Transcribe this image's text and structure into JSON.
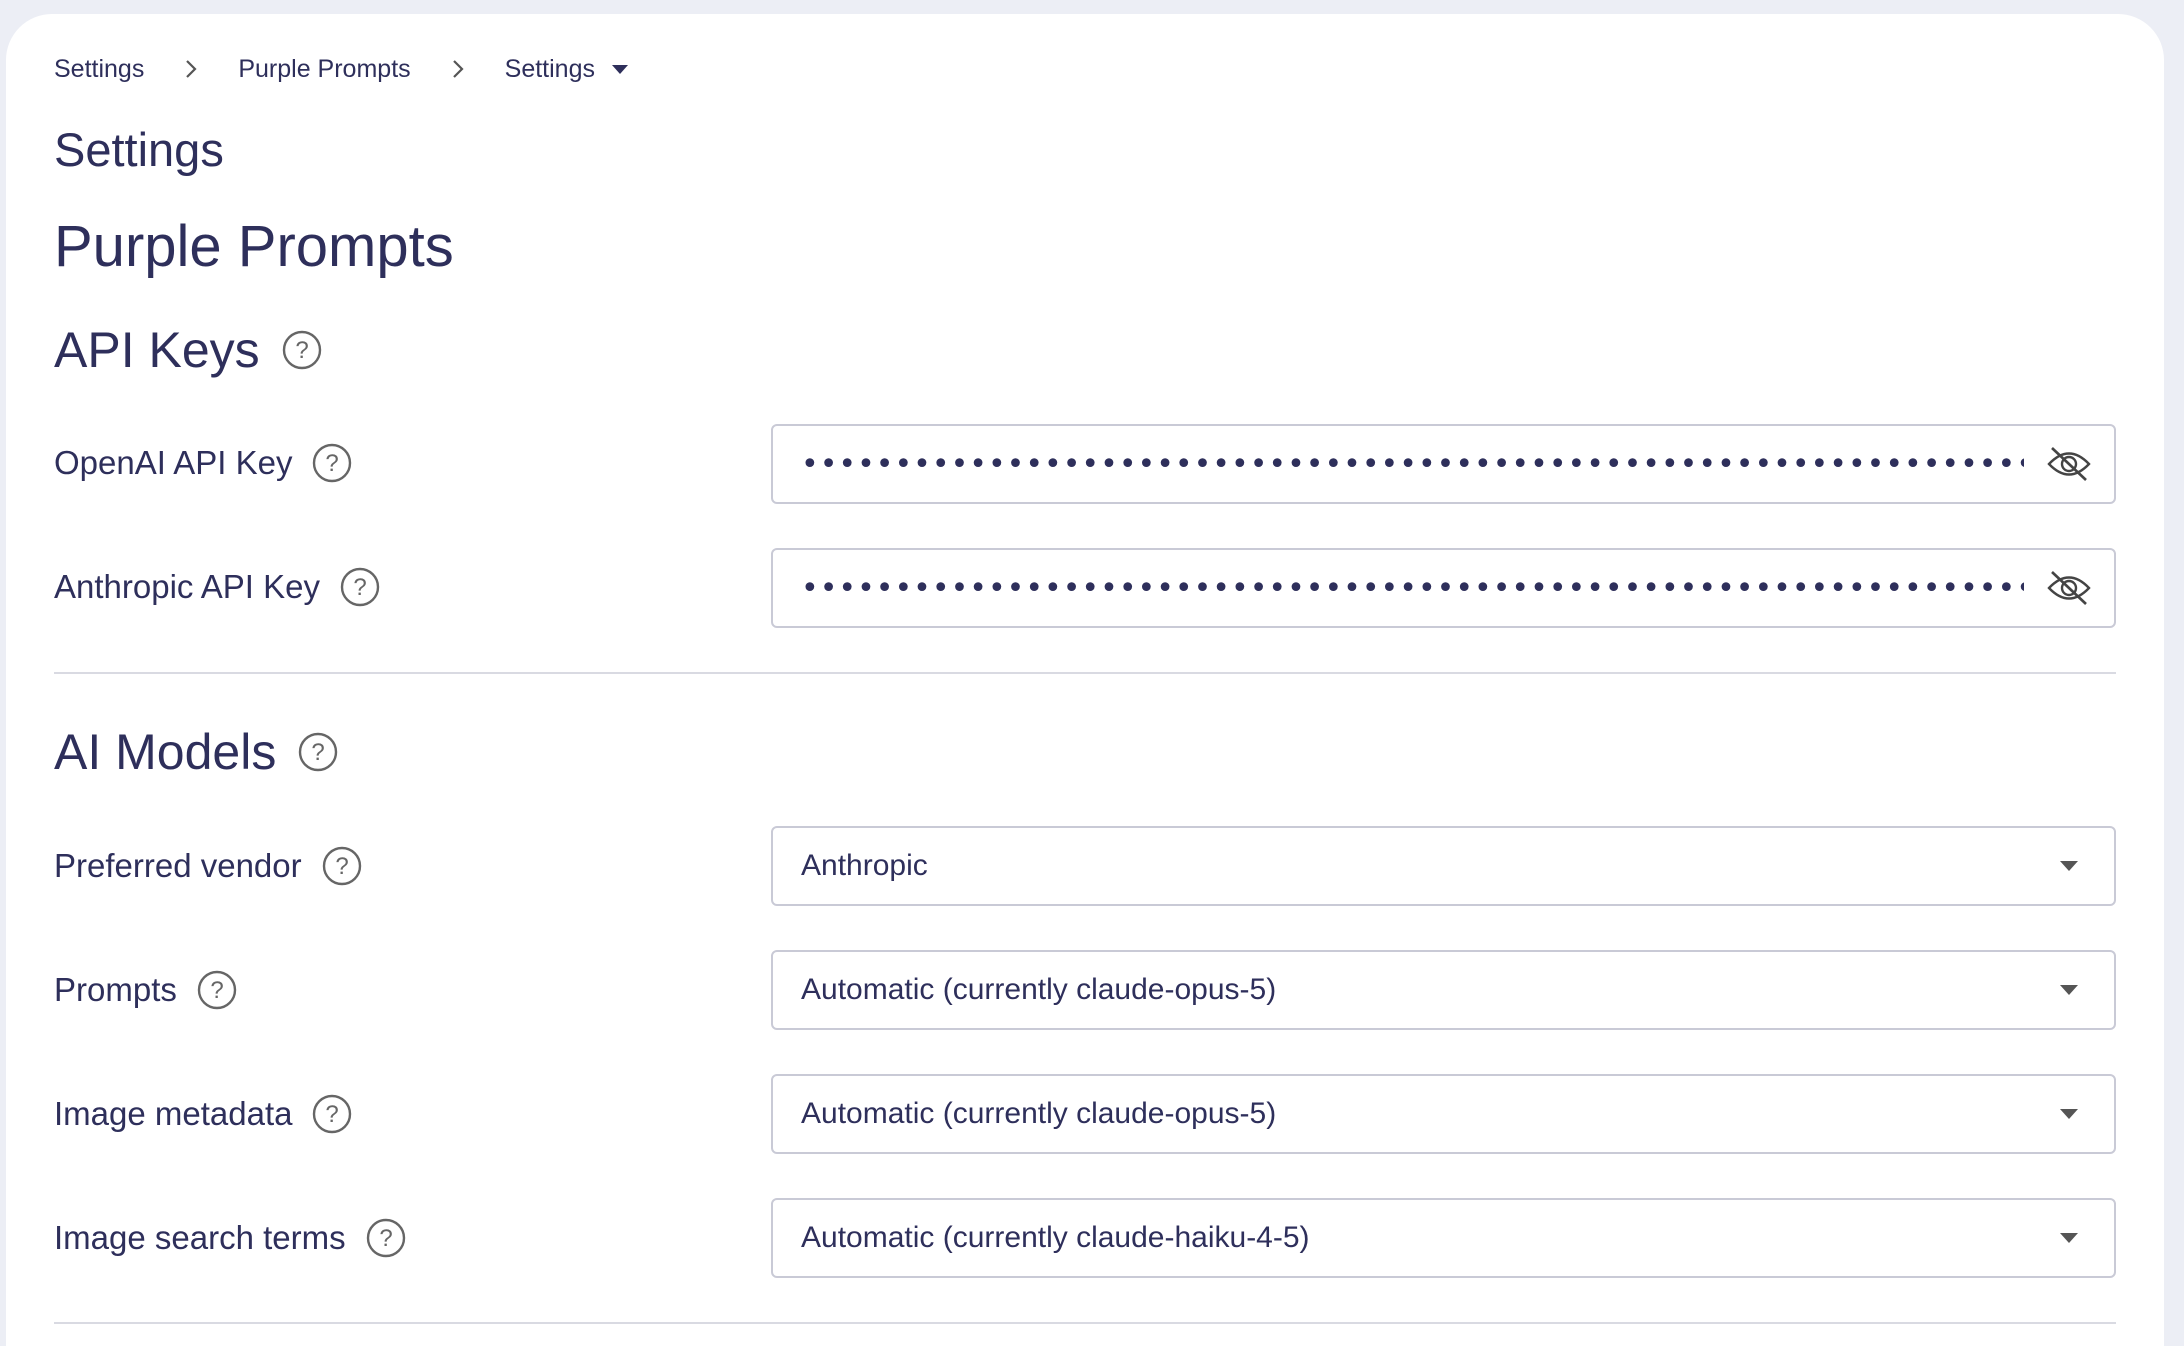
{
  "breadcrumb": {
    "items": [
      "Settings",
      "Purple Prompts",
      "Settings"
    ]
  },
  "page": {
    "title": "Settings",
    "project": "Purple Prompts"
  },
  "api_keys": {
    "heading": "API Keys",
    "openai": {
      "label": "OpenAI API Key",
      "value": "••••••••••••••••••••••••••••••••••••••••••••••••••••••••••••••••••••••••••••••••••"
    },
    "anthropic": {
      "label": "Anthropic API Key",
      "value": "••••••••••••••••••••••••••••••••••••••••••••••••••••••••••••••••••••••••••••••••••"
    }
  },
  "ai_models": {
    "heading": "AI Models",
    "preferred_vendor": {
      "label": "Preferred vendor",
      "value": "Anthropic"
    },
    "prompts": {
      "label": "Prompts",
      "value": "Automatic (currently claude-opus-5)"
    },
    "image_metadata": {
      "label": "Image metadata",
      "value": "Automatic (currently claude-opus-5)"
    },
    "image_search_terms": {
      "label": "Image search terms",
      "value": "Automatic (currently claude-haiku-4-5)"
    }
  },
  "icons": {
    "help": "question-circle-icon",
    "visibility": "eye-off-icon",
    "dropdown": "caret-down-icon",
    "breadcrumb_separator": "chevron-right-icon"
  },
  "colors": {
    "text": "#2e2f5b",
    "background": "#eceef5",
    "card": "#ffffff",
    "border": "#c9cad6",
    "icon": "#666666"
  }
}
